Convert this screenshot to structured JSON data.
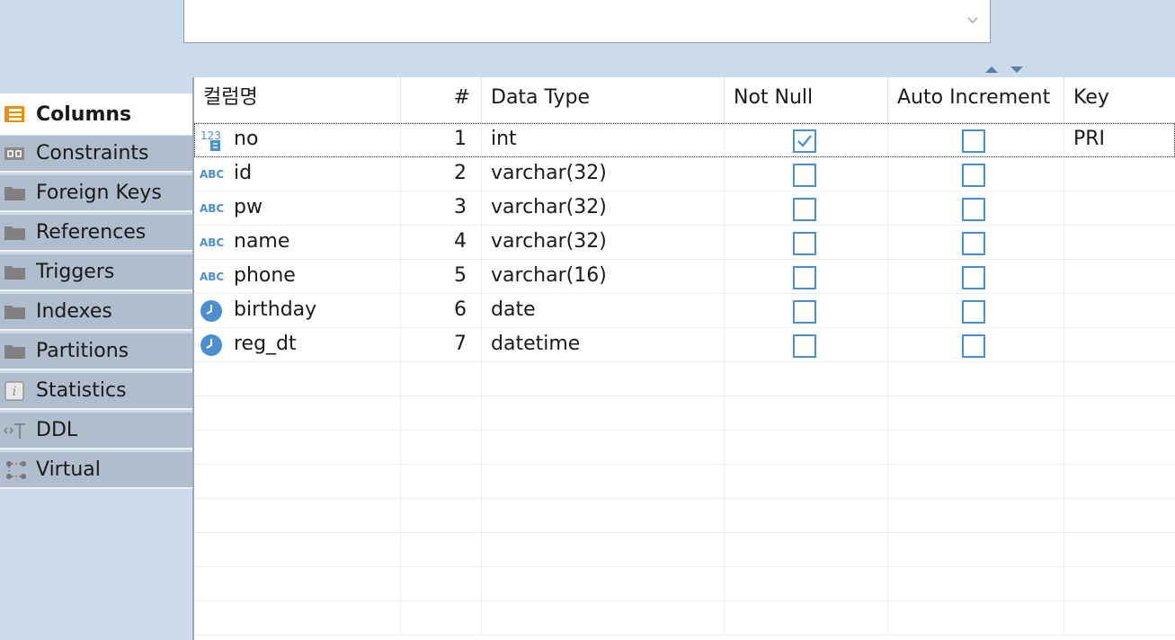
{
  "tabs": [
    {
      "label": "Columns",
      "icon": "columns-icon",
      "active": true
    },
    {
      "label": "Constraints",
      "icon": "constraints-icon"
    },
    {
      "label": "Foreign Keys",
      "icon": "folder-icon"
    },
    {
      "label": "References",
      "icon": "folder-icon"
    },
    {
      "label": "Triggers",
      "icon": "folder-icon"
    },
    {
      "label": "Indexes",
      "icon": "folder-icon"
    },
    {
      "label": "Partitions",
      "icon": "folder-icon"
    },
    {
      "label": "Statistics",
      "icon": "info-icon"
    },
    {
      "label": "DDL",
      "icon": "ddl-icon"
    },
    {
      "label": "Virtual",
      "icon": "virtual-icon"
    }
  ],
  "grid": {
    "headers": [
      "컬럼명",
      "#",
      "Data Type",
      "Not Null",
      "Auto Increment",
      "Key"
    ],
    "rows": [
      {
        "type": "numeric",
        "name": "no",
        "num": "1",
        "datatype": "int",
        "not_null": true,
        "auto_inc": false,
        "key": "PRI"
      },
      {
        "type": "text",
        "name": "id",
        "num": "2",
        "datatype": "varchar(32)",
        "not_null": false,
        "auto_inc": false,
        "key": ""
      },
      {
        "type": "text",
        "name": "pw",
        "num": "3",
        "datatype": "varchar(32)",
        "not_null": false,
        "auto_inc": false,
        "key": ""
      },
      {
        "type": "text",
        "name": "name",
        "num": "4",
        "datatype": "varchar(32)",
        "not_null": false,
        "auto_inc": false,
        "key": ""
      },
      {
        "type": "text",
        "name": "phone",
        "num": "5",
        "datatype": "varchar(16)",
        "not_null": false,
        "auto_inc": false,
        "key": ""
      },
      {
        "type": "datetime",
        "name": "birthday",
        "num": "6",
        "datatype": "date",
        "not_null": false,
        "auto_inc": false,
        "key": ""
      },
      {
        "type": "datetime",
        "name": "reg_dt",
        "num": "7",
        "datatype": "datetime",
        "not_null": false,
        "auto_inc": false,
        "key": ""
      }
    ],
    "type_icon_labels": {
      "numeric": "123",
      "text": "ABC"
    }
  },
  "colors": {
    "accent": "#4a8fcf",
    "panel_bg": "#ccdbea",
    "tab_bg": "#afbdcc",
    "active_tab_icon": "#f08c00"
  }
}
